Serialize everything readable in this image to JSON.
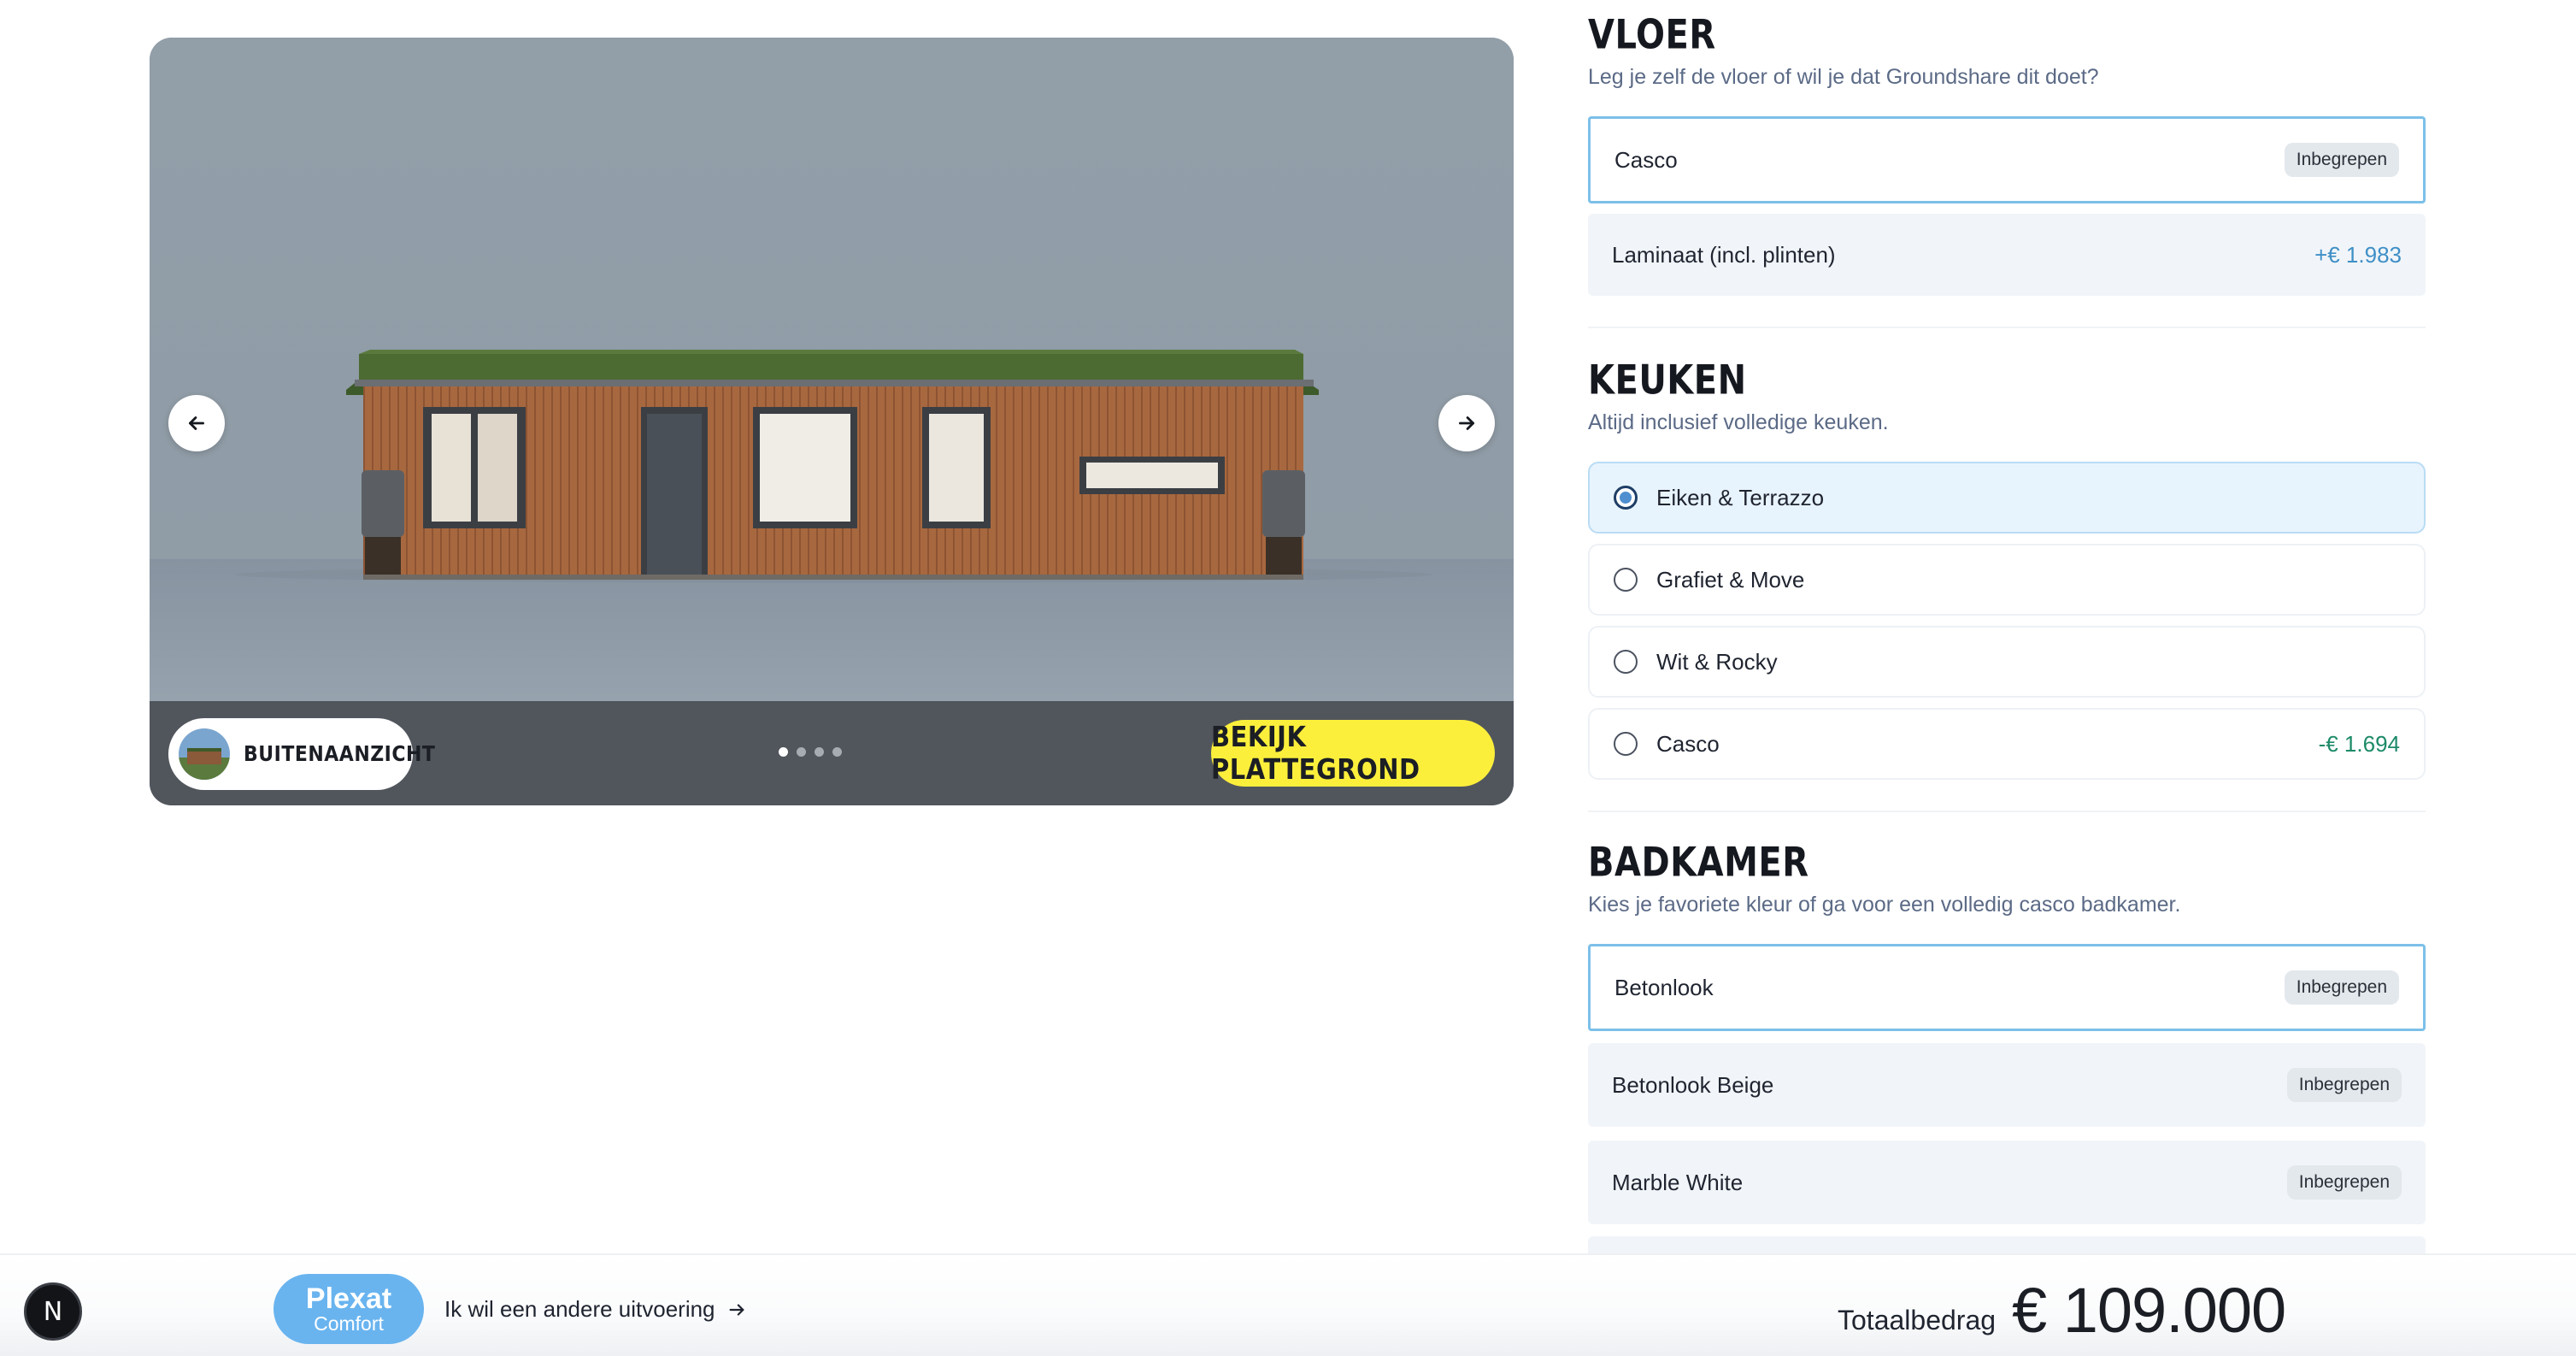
{
  "gallery": {
    "view_label": "BUITENAANZICHT",
    "plan_button": "BEKIJK PLATTEGROND",
    "dots": 4,
    "active_dot": 0
  },
  "sections": {
    "vloer": {
      "title": "VLOER",
      "subtitle": "Leg je zelf de vloer of wil je dat Groundshare dit doet?",
      "options": [
        {
          "label": "Casco",
          "tag": "Inbegrepen"
        },
        {
          "label": "Laminaat (incl. plinten)",
          "price": "+€ 1.983"
        }
      ]
    },
    "keuken": {
      "title": "KEUKEN",
      "subtitle": "Altijd inclusief volledige keuken.",
      "options": [
        {
          "label": "Eiken & Terrazzo"
        },
        {
          "label": "Grafiet & Move"
        },
        {
          "label": "Wit & Rocky"
        },
        {
          "label": "Casco",
          "price": "-€ 1.694"
        }
      ]
    },
    "badkamer": {
      "title": "BADKAMER",
      "subtitle": "Kies je favoriete kleur of ga voor een volledig casco badkamer.",
      "options": [
        {
          "label": "Betonlook",
          "tag": "Inbegrepen"
        },
        {
          "label": "Betonlook Beige",
          "tag": "Inbegrepen"
        },
        {
          "label": "Marble White",
          "tag": "Inbegrepen"
        }
      ]
    }
  },
  "footer": {
    "next_badge": "N",
    "model_name": "Plexat",
    "model_variant": "Comfort",
    "alt_link": "Ik wil een andere uitvoering",
    "total_label": "Totaalbedrag",
    "total_value": "€ 109.000"
  },
  "colors": {
    "accent_yellow": "#fcef3c",
    "accent_blue": "#69b4ef",
    "selected_border": "#7cc0e9",
    "price_positive": "#3f8fc6",
    "price_negative": "#1d8a68"
  },
  "icons": {
    "prev": "arrow-left-icon",
    "next": "arrow-right-icon",
    "alt_link": "arrow-right-icon"
  }
}
